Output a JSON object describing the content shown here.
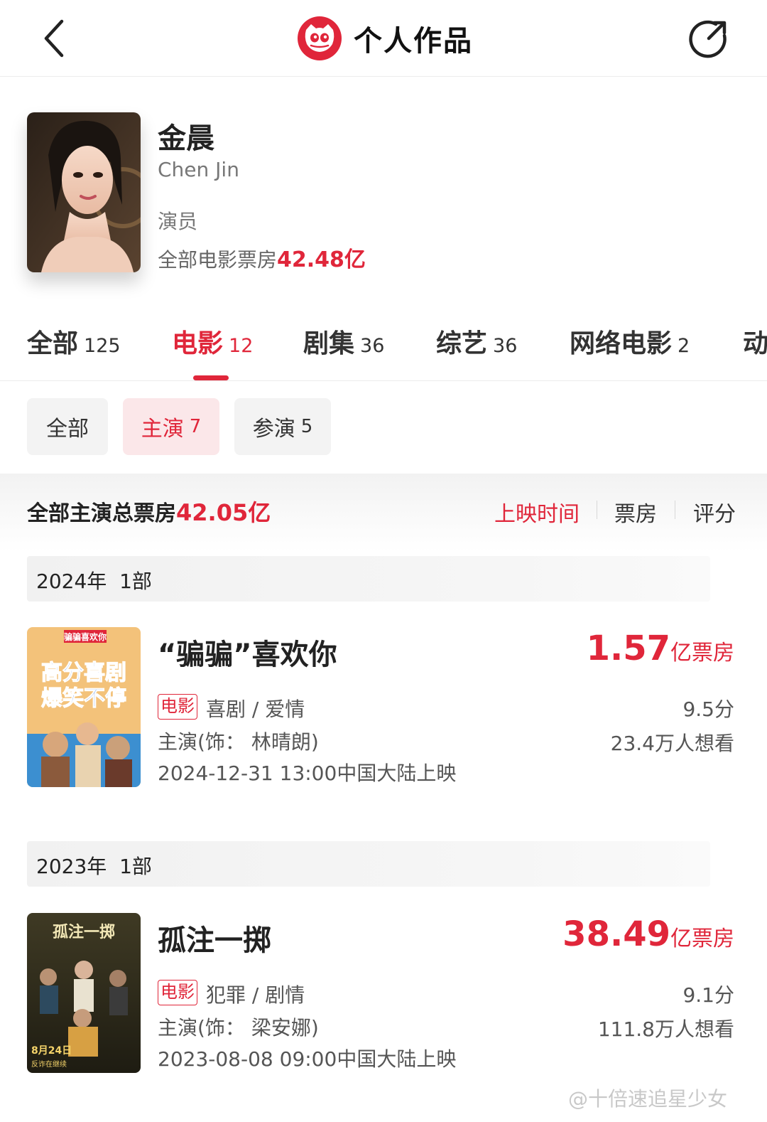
{
  "header": {
    "title": "个人作品",
    "back_icon": "chevron-left-icon",
    "share_icon": "share-icon",
    "logo_icon": "cat-logo-icon",
    "accent": "#e0263a"
  },
  "profile": {
    "name": "金晨",
    "name_en": "Chen Jin",
    "role": "演员",
    "box_office_label": "全部电影票房",
    "box_office_value": "42.48亿"
  },
  "tabs": [
    {
      "label": "全部",
      "count": "125",
      "active": false
    },
    {
      "label": "电影",
      "count": "12",
      "active": true
    },
    {
      "label": "剧集",
      "count": "36",
      "active": false
    },
    {
      "label": "综艺",
      "count": "36",
      "active": false
    },
    {
      "label": "网络电影",
      "count": "2",
      "active": false
    },
    {
      "label": "动",
      "count": "",
      "active": false
    }
  ],
  "filters": [
    {
      "label": "全部",
      "count": "",
      "active": false
    },
    {
      "label": "主演",
      "count": "7",
      "active": true
    },
    {
      "label": "参演",
      "count": "5",
      "active": false
    }
  ],
  "summary": {
    "label": "全部主演总票房",
    "value": "42.05亿",
    "sort": [
      "上映时间",
      "票房",
      "评分"
    ],
    "sort_active": "上映时间"
  },
  "sections": [
    {
      "year": "2024年",
      "count": "1部",
      "movie": {
        "title": "“骗骗”喜欢你",
        "box_num": "1.57",
        "box_unit": "亿票房",
        "tag": "电影",
        "genre": "喜剧 / 爱情",
        "role": "主演(饰：  林晴朗)",
        "release": "2024-12-31 13:00中国大陆上映",
        "score": "9.5分",
        "want": "23.4万人想看",
        "poster_text": "高分喜剧爆笑不停",
        "poster_top": "骗骗喜欢你"
      }
    },
    {
      "year": "2023年",
      "count": "1部",
      "movie": {
        "title": "孤注一掷",
        "box_num": "38.49",
        "box_unit": "亿票房",
        "tag": "电影",
        "genre": "犯罪 / 剧情",
        "role": "主演(饰：  梁安娜)",
        "release": "2023-08-08 09:00中国大陆上映",
        "score": "9.1分",
        "want": "111.8万人想看",
        "poster_text": "孤注一掷",
        "poster_date": "8月24日",
        "poster_sub": "反诈在继续"
      }
    }
  ],
  "watermark": "@十倍速追星少女"
}
